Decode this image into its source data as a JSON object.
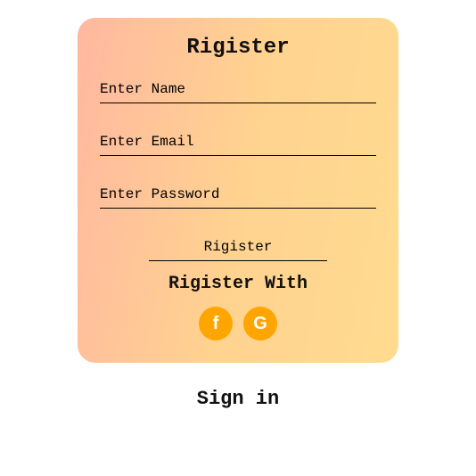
{
  "card": {
    "title": "Rigister",
    "name_placeholder": "Enter Name",
    "email_placeholder": "Enter Email",
    "password_placeholder": "Enter Password",
    "submit_label": "Rigister",
    "social_title": "Rigister With",
    "facebook_label": "f",
    "google_label": "G"
  },
  "signin_label": "Sign in",
  "colors": {
    "accent": "#ffa500",
    "gradient_start": "#ffb8a0",
    "gradient_end": "#ffdb8f"
  }
}
